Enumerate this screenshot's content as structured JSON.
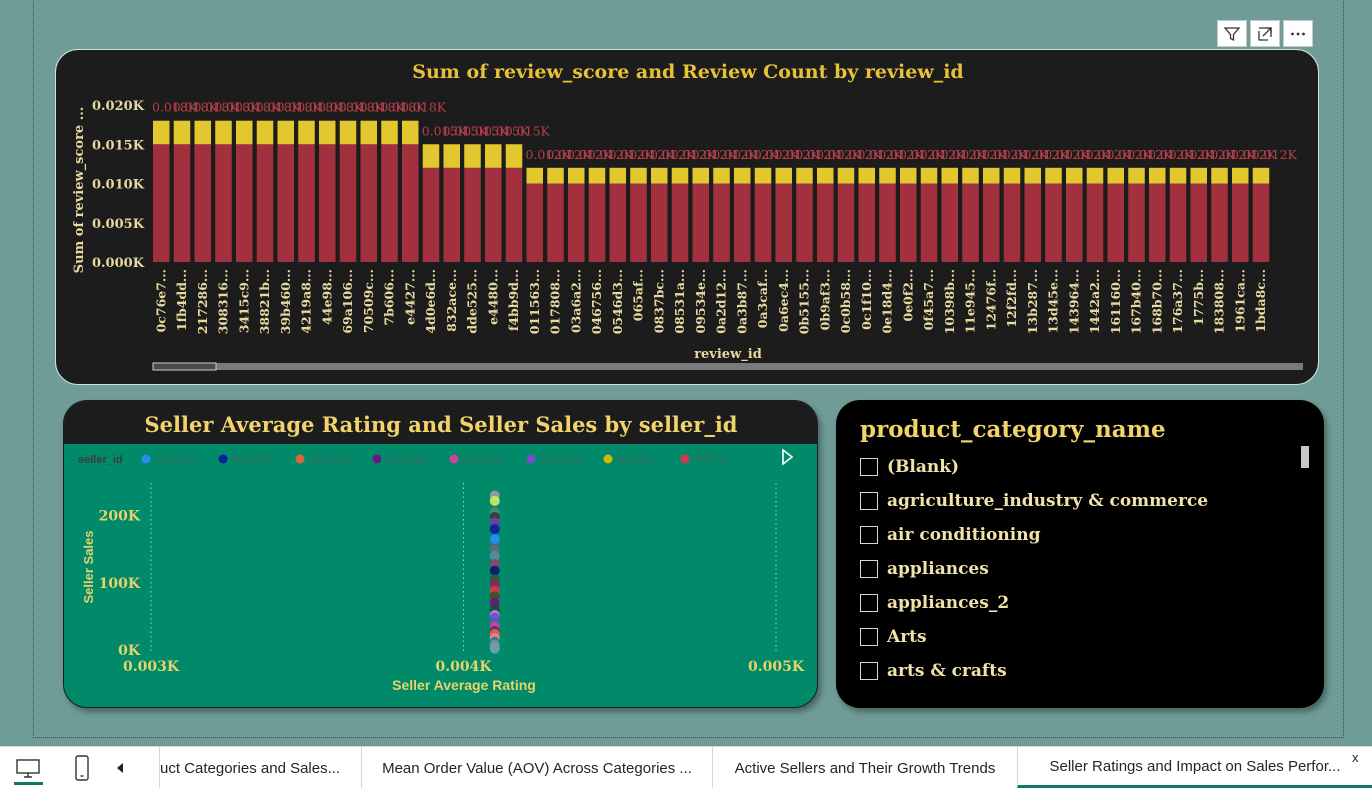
{
  "visual_toolbar": {
    "icons": [
      "filter-icon",
      "focus-mode-icon",
      "more-options-icon"
    ]
  },
  "bar_chart": {
    "chart_data": {
      "type": "bar",
      "stacked": true,
      "title": "Sum of review_score and Review Count by review_id",
      "xlabel": "review_id",
      "ylabel": "Sum of review_score ...",
      "ylim": [
        0,
        0.02
      ],
      "ytick_labels": [
        "0.000K",
        "0.005K",
        "0.010K",
        "0.015K",
        "0.020K"
      ],
      "categories": [
        "0c76e7...",
        "1fb4dd...",
        "217286...",
        "308316...",
        "3415c9...",
        "38821b...",
        "39b460...",
        "4219a8...",
        "44e98...",
        "69a106...",
        "70509c...",
        "7b606...",
        "e4427...",
        "4d0e6d...",
        "832ace...",
        "dde525...",
        "e4480...",
        "f4bb9d...",
        "011563...",
        "017808...",
        "03a6a2...",
        "046756...",
        "0546d3...",
        "065af...",
        "0837bc...",
        "08531a...",
        "09534e...",
        "0a2d12...",
        "0a3b87...",
        "0a3caf...",
        "0a6ec4...",
        "0b5155...",
        "0b9af3...",
        "0c0b58...",
        "0c1f10...",
        "0e18d4...",
        "0e0f2...",
        "0f45a7...",
        "10398b...",
        "11e945...",
        "12476f...",
        "12f2fd...",
        "13b287...",
        "13d45e...",
        "143964...",
        "1442a2...",
        "161160...",
        "167b40...",
        "168b70...",
        "176a37...",
        "1775b...",
        "183808...",
        "1961ca...",
        "1bda8c..."
      ],
      "series": [
        {
          "name": "Sum of review_score",
          "color": "#a3303e",
          "values": [
            0.015,
            0.015,
            0.015,
            0.015,
            0.015,
            0.015,
            0.015,
            0.015,
            0.015,
            0.015,
            0.015,
            0.015,
            0.015,
            0.012,
            0.012,
            0.012,
            0.012,
            0.012,
            0.01,
            0.01,
            0.01,
            0.01,
            0.01,
            0.01,
            0.01,
            0.01,
            0.01,
            0.01,
            0.01,
            0.01,
            0.01,
            0.01,
            0.01,
            0.01,
            0.01,
            0.01,
            0.01,
            0.01,
            0.01,
            0.01,
            0.01,
            0.01,
            0.01,
            0.01,
            0.01,
            0.01,
            0.01,
            0.01,
            0.01,
            0.01,
            0.01,
            0.01,
            0.01,
            0.01
          ]
        },
        {
          "name": "Review Count",
          "color": "#e3c72e",
          "values": [
            0.003,
            0.003,
            0.003,
            0.003,
            0.003,
            0.003,
            0.003,
            0.003,
            0.003,
            0.003,
            0.003,
            0.003,
            0.003,
            0.003,
            0.003,
            0.003,
            0.003,
            0.003,
            0.002,
            0.002,
            0.002,
            0.002,
            0.002,
            0.002,
            0.002,
            0.002,
            0.002,
            0.002,
            0.002,
            0.002,
            0.002,
            0.002,
            0.002,
            0.002,
            0.002,
            0.002,
            0.002,
            0.002,
            0.002,
            0.002,
            0.002,
            0.002,
            0.002,
            0.002,
            0.002,
            0.002,
            0.002,
            0.002,
            0.002,
            0.002,
            0.002,
            0.002,
            0.002,
            0.002
          ]
        }
      ],
      "total_labels": [
        "0.018K",
        "0.018K",
        "0.018K",
        "0.018K",
        "0.018K",
        "0.018K",
        "0.018K",
        "0.018K",
        "0.018K",
        "0.018K",
        "0.018K",
        "0.018K",
        "0.018K",
        "0.015K",
        "0.015K",
        "0.015K",
        "0.015K",
        "0.015K",
        "0.012K",
        "0.012K",
        "0.012K",
        "0.012K",
        "0.012K",
        "0.012K",
        "0.012K",
        "0.012K",
        "0.012K",
        "0.012K",
        "0.012K",
        "0.012K",
        "0.012K",
        "0.012K",
        "0.012K",
        "0.012K",
        "0.012K",
        "0.012K",
        "0.012K",
        "0.012K",
        "0.012K",
        "0.012K",
        "0.012K",
        "0.012K",
        "0.012K",
        "0.012K",
        "0.012K",
        "0.012K",
        "0.012K",
        "0.012K",
        "0.012K",
        "0.012K",
        "0.012K",
        "0.012K",
        "0.012K",
        "0.012K"
      ],
      "label_color": "#b5404a",
      "grid": false,
      "legend": "none"
    }
  },
  "scatter_chart": {
    "chart_data": {
      "type": "scatter",
      "title": "Seller Average Rating and Seller Sales by seller_id",
      "xlabel": "Seller Average Rating",
      "ylabel": "Seller Sales",
      "xlim": [
        0.003,
        0.005
      ],
      "ylim": [
        0,
        250000
      ],
      "xtick_labels": [
        "0.003K",
        "0.004K",
        "0.005K"
      ],
      "ytick_labels": [
        "0K",
        "100K",
        "200K"
      ],
      "legend_title": "seller_id",
      "legend_items": [
        {
          "label": "001cca7...",
          "color": "#2a8cf0"
        },
        {
          "label": "002100f...",
          "color": "#0c1e9c"
        },
        {
          "label": "004c09d...",
          "color": "#e0643a"
        },
        {
          "label": "00720ab...",
          "color": "#6a1683"
        },
        {
          "label": "00ab3eff...",
          "color": "#d43f9c"
        },
        {
          "label": "00d8b14...",
          "color": "#7a4ad0"
        },
        {
          "label": "00ee68...",
          "color": "#d4b800"
        },
        {
          "label": "00fc707...",
          "color": "#d23a4a"
        }
      ],
      "legend": "top",
      "points_x": 0.0041,
      "points_y": [
        230000,
        222000,
        205000,
        198000,
        190000,
        180000,
        165000,
        150000,
        140000,
        128000,
        118000,
        105000,
        98000,
        88000,
        80000,
        70000,
        60000,
        52000,
        48000,
        40000,
        35000,
        28000,
        24000,
        18000,
        12000,
        8000,
        5000,
        2000
      ],
      "point_colors": [
        "#9a9a9a",
        "#c8e86a",
        "#4a8a6a",
        "#3a3a3a",
        "#6a40b0",
        "#1a1aa0",
        "#2a8cf0",
        "#6a6a7a",
        "#5a8aa0",
        "#884a6a",
        "#0c1e6c",
        "#2a5a40",
        "#8a2a5a",
        "#d23a4a",
        "#4a4a2a",
        "#6a1683",
        "#1a4a3a",
        "#c080e0",
        "#7a4ad0",
        "#3a6aa0",
        "#d43f9c",
        "#5a2a7a",
        "#e0643a",
        "#e080a0",
        "#2a7a8a",
        "#5a9ab0",
        "#8a8a8a",
        "#6aa0b0"
      ],
      "grid": "vertical-dotted"
    }
  },
  "slicer": {
    "title": "product_category_name",
    "items": [
      "(Blank)",
      "agriculture_industry & commerce",
      "air conditioning",
      "appliances",
      "appliances_2",
      "Arts",
      "arts & crafts"
    ]
  },
  "tabs": {
    "items": [
      {
        "label": "uct Categories and Sales..."
      },
      {
        "label": "Mean Order Value (AOV) Across Categories ..."
      },
      {
        "label": "Active Sellers and Their Growth Trends"
      },
      {
        "label": "Seller Ratings and Impact on Sales Perfor..."
      }
    ],
    "active_index": 3,
    "close_label": "x"
  }
}
